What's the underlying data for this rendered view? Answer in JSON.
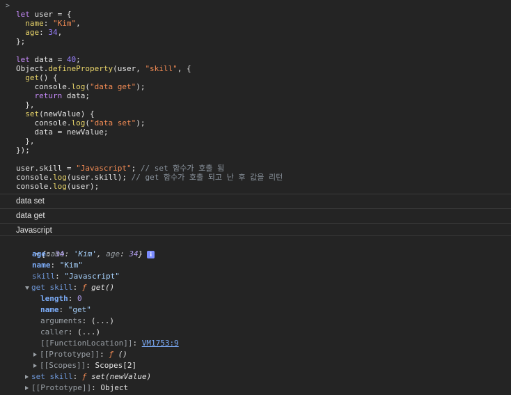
{
  "prompt_chevron": ">",
  "code": {
    "l1_kw": "let",
    "l1_var": " user = {",
    "l2_key": "  name",
    "l2_colon": ": ",
    "l2_val": "\"Kim\"",
    "l2_end": ",",
    "l3_key": "  age",
    "l3_colon": ": ",
    "l3_val": "34",
    "l3_end": ",",
    "l4": "};",
    "l6_kw": "let",
    "l6_var": " data = ",
    "l6_val": "40",
    "l6_end": ";",
    "l7_obj": "Object.",
    "l7_fn": "defineProperty",
    "l7_args": "(user, ",
    "l7_str": "\"skill\"",
    "l7_end": ", {",
    "l8_fn": "  get",
    "l8_end": "() {",
    "l9_a": "    console.",
    "l9_fn": "log",
    "l9_b": "(",
    "l9_str": "\"data get\"",
    "l9_c": ");",
    "l10_kw": "    return",
    "l10_end": " data;",
    "l11": "  },",
    "l12_fn": "  set",
    "l12_end": "(newValue) {",
    "l13_a": "    console.",
    "l13_fn": "log",
    "l13_b": "(",
    "l13_str": "\"data set\"",
    "l13_c": ");",
    "l14": "    data = newValue;",
    "l15": "  },",
    "l16": "});",
    "l18_a": "user.skill = ",
    "l18_str": "\"Javascript\"",
    "l18_b": "; ",
    "l18_comment": "// set 함수가 호출 됨",
    "l19_a": "console.",
    "l19_fn": "log",
    "l19_b": "(user.skill); ",
    "l19_comment": "// get 함수가 호출 되고 난 후 값을 리턴",
    "l20_a": "console.",
    "l20_fn": "log",
    "l20_b": "(user);"
  },
  "messages": [
    "data set",
    "data get",
    "Javascript"
  ],
  "object": {
    "summary_open": "{",
    "summary_name_key": "name",
    "summary_name_val": "'Kim'",
    "summary_sep": ", ",
    "summary_age_key": "age",
    "summary_age_val": "34",
    "summary_close": "}",
    "info_badge": "i",
    "age_key": "age",
    "age_val": "34",
    "name_key": "name",
    "name_val": "\"Kim\"",
    "skill_key": "skill",
    "skill_val": "\"Javascript\"",
    "get_skill_key": "get skill",
    "get_f": "ƒ",
    "get_sig": "get()",
    "length_key": "length",
    "length_val": "0",
    "fname_key": "name",
    "fname_val": "\"get\"",
    "arguments_key": "arguments",
    "arguments_val": "(...)",
    "caller_key": "caller",
    "caller_val": "(...)",
    "location_key": "[[FunctionLocation]]",
    "location_val": "VM1753:9",
    "prototype_fn_key": "[[Prototype]]",
    "prototype_fn_f": "ƒ",
    "prototype_fn_val": "()",
    "scopes_key": "[[Scopes]]",
    "scopes_val": "Scopes[2]",
    "set_skill_key": "set skill",
    "set_f": "ƒ",
    "set_sig": "set(newValue)",
    "prototype_key": "[[Prototype]]",
    "prototype_val": "Object"
  }
}
